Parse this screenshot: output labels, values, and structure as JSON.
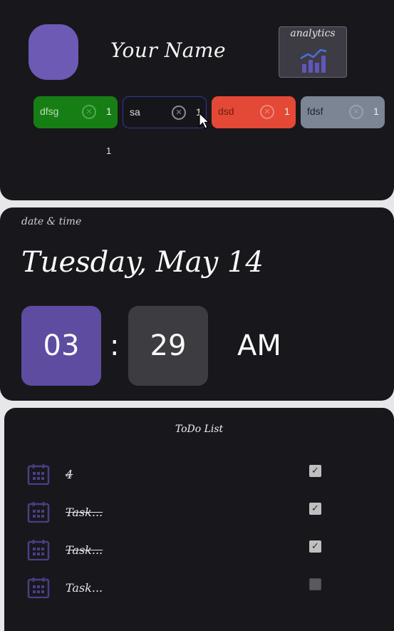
{
  "profile": {
    "name": "Your Name",
    "analytics_label": "analytics"
  },
  "chips": [
    {
      "label": "dfsg",
      "count": "1",
      "color": "#177e15"
    },
    {
      "label": "sa",
      "count": "1",
      "color": "#16161a"
    },
    {
      "label": "dsd",
      "count": "1",
      "color": "#e34936"
    },
    {
      "label": "fdsf",
      "count": "1",
      "color": "#7b8594"
    }
  ],
  "chip_summary_count": "1",
  "datetime": {
    "label": "date & time",
    "date": "Tuesday, May 14",
    "hour": "03",
    "colon": ":",
    "minute": "29",
    "ampm": "AM"
  },
  "todo": {
    "title": "ToDo List",
    "items": [
      {
        "text": "4",
        "done": true,
        "checked": true
      },
      {
        "text": "Task...",
        "done": true,
        "checked": true
      },
      {
        "text": "Task...",
        "done": true,
        "checked": true
      },
      {
        "text": "Task...",
        "done": false,
        "checked": false
      }
    ]
  },
  "icons": {
    "chip_remove": "close-circle-icon",
    "analytics": "bar-chart-icon",
    "todo_item": "calendar-icon",
    "checkbox": "checkbox-icon"
  },
  "colors": {
    "accent_purple": "#5e4ca1",
    "avatar_purple": "#6c5ab4",
    "card_bg": "#18171c",
    "minute_box": "#3d3c41"
  }
}
